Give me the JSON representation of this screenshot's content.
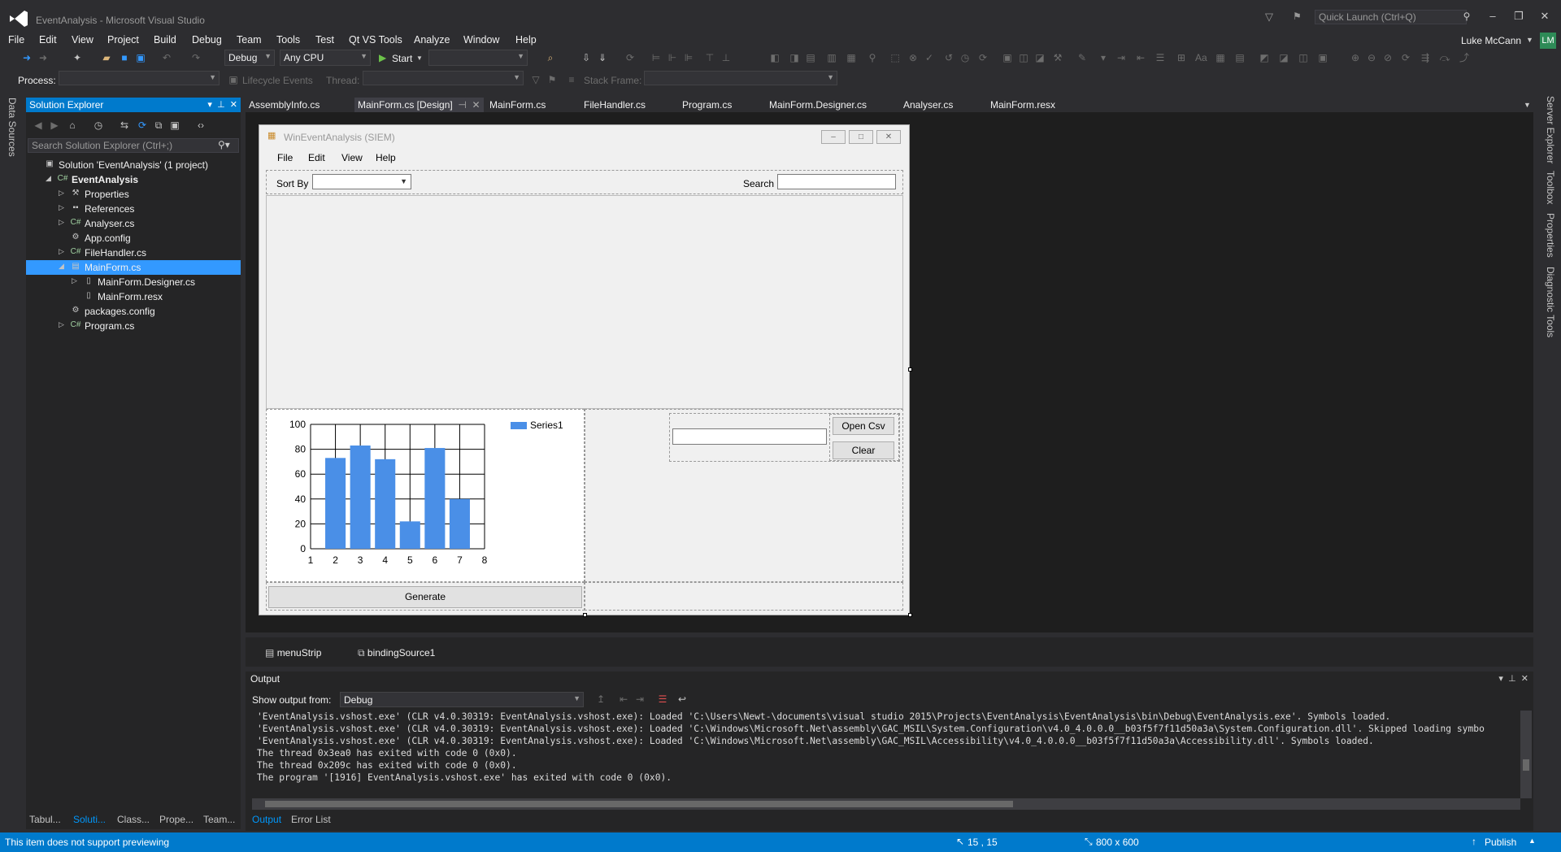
{
  "window": {
    "title": "EventAnalysis - Microsoft Visual Studio",
    "quick_launch_placeholder": "Quick Launch (Ctrl+Q)",
    "user_name": "Luke McCann",
    "user_initials": "LM"
  },
  "menu": [
    "File",
    "Edit",
    "View",
    "Project",
    "Build",
    "Debug",
    "Team",
    "Tools",
    "Test",
    "Qt VS Tools",
    "Analyze",
    "Window",
    "Help"
  ],
  "toolbar": {
    "config": "Debug",
    "platform": "Any CPU",
    "start_label": "Start",
    "process_label": "Process:",
    "lifecycle_label": "Lifecycle Events",
    "thread_label": "Thread:",
    "stack_frame_label": "Stack Frame:"
  },
  "left_vtabs": [
    "Data Sources"
  ],
  "right_vtabs": [
    "Server Explorer",
    "Toolbox",
    "Properties",
    "Diagnostic Tools"
  ],
  "solution_explorer": {
    "title": "Solution Explorer",
    "search_placeholder": "Search Solution Explorer (Ctrl+;)",
    "items": [
      {
        "label": "Solution 'EventAnalysis' (1 project)",
        "level": 0,
        "expander": "",
        "icon": "solution-icon",
        "bold": false
      },
      {
        "label": "EventAnalysis",
        "level": 1,
        "expander": "◢",
        "icon": "csharp-project-icon",
        "bold": true
      },
      {
        "label": "Properties",
        "level": 2,
        "expander": "▷",
        "icon": "wrench-icon",
        "bold": false
      },
      {
        "label": "References",
        "level": 2,
        "expander": "▷",
        "icon": "references-icon",
        "bold": false
      },
      {
        "label": "Analyser.cs",
        "level": 2,
        "expander": "▷",
        "icon": "csharp-file-icon",
        "bold": false
      },
      {
        "label": "App.config",
        "level": 2,
        "expander": "",
        "icon": "config-file-icon",
        "bold": false
      },
      {
        "label": "FileHandler.cs",
        "level": 2,
        "expander": "▷",
        "icon": "csharp-file-icon",
        "bold": false
      },
      {
        "label": "MainForm.cs",
        "level": 2,
        "expander": "◢",
        "icon": "form-file-icon",
        "bold": false,
        "selected": true
      },
      {
        "label": "MainForm.Designer.cs",
        "level": 3,
        "expander": "▷",
        "icon": "designer-file-icon",
        "bold": false
      },
      {
        "label": "MainForm.resx",
        "level": 3,
        "expander": "",
        "icon": "resx-file-icon",
        "bold": false
      },
      {
        "label": "packages.config",
        "level": 2,
        "expander": "",
        "icon": "config-file-icon",
        "bold": false
      },
      {
        "label": "Program.cs",
        "level": 2,
        "expander": "▷",
        "icon": "csharp-file-icon",
        "bold": false
      }
    ]
  },
  "left_bottom_tabs": [
    "Tabul...",
    "Soluti...",
    "Class...",
    "Prope...",
    "Team..."
  ],
  "doc_tabs": [
    "AssemblyInfo.cs",
    "MainForm.cs [Design]",
    "MainForm.cs",
    "FileHandler.cs",
    "Program.cs",
    "MainForm.Designer.cs",
    "Analyser.cs",
    "MainForm.resx"
  ],
  "form": {
    "title": "WinEventAnalysis (SIEM)",
    "menu": [
      "File",
      "Edit",
      "View",
      "Help"
    ],
    "sort_by_label": "Sort By",
    "search_label": "Search",
    "open_csv_label": "Open Csv",
    "clear_label": "Clear",
    "generate_label": "Generate"
  },
  "chart_data": {
    "type": "bar",
    "categories": [
      "2",
      "3",
      "4",
      "5",
      "6",
      "7"
    ],
    "x_ticks": [
      "1",
      "2",
      "3",
      "4",
      "5",
      "6",
      "7",
      "8"
    ],
    "series": [
      {
        "name": "Series1",
        "values": [
          73,
          83,
          72,
          22,
          81,
          40
        ]
      }
    ],
    "y_ticks": [
      "100",
      "80",
      "60",
      "40",
      "20",
      "0"
    ],
    "ylim": [
      0,
      100
    ],
    "xlim": [
      1,
      8
    ],
    "grid": true,
    "legend_position": "top-right",
    "bar_color": "#4a8fe7"
  },
  "tray": [
    "menuStrip",
    "bindingSource1"
  ],
  "output": {
    "title": "Output",
    "show_output_from_label": "Show output from:",
    "source": "Debug",
    "lines": [
      "'EventAnalysis.vshost.exe' (CLR v4.0.30319: EventAnalysis.vshost.exe): Loaded 'C:\\Users\\Newt-\\documents\\visual studio 2015\\Projects\\EventAnalysis\\EventAnalysis\\bin\\Debug\\EventAnalysis.exe'. Symbols loaded.",
      "'EventAnalysis.vshost.exe' (CLR v4.0.30319: EventAnalysis.vshost.exe): Loaded 'C:\\Windows\\Microsoft.Net\\assembly\\GAC_MSIL\\System.Configuration\\v4.0_4.0.0.0__b03f5f7f11d50a3a\\System.Configuration.dll'. Skipped loading symbo",
      "'EventAnalysis.vshost.exe' (CLR v4.0.30319: EventAnalysis.vshost.exe): Loaded 'C:\\Windows\\Microsoft.Net\\assembly\\GAC_MSIL\\Accessibility\\v4.0_4.0.0.0__b03f5f7f11d50a3a\\Accessibility.dll'. Symbols loaded.",
      "The thread 0x3ea0 has exited with code 0 (0x0).",
      "The thread 0x209c has exited with code 0 (0x0).",
      "The program '[1916] EventAnalysis.vshost.exe' has exited with code 0 (0x0)."
    ]
  },
  "output_tabs": [
    "Output",
    "Error List"
  ],
  "status": {
    "message": "This item does not support previewing",
    "position": "15 , 15",
    "size": "800 x 600",
    "publish": "Publish"
  },
  "colors": {
    "accent": "#007acc",
    "selection": "#3399ff",
    "background": "#2d2d30"
  }
}
